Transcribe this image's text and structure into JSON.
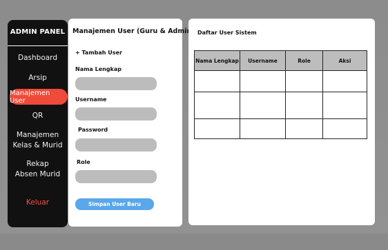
{
  "sidebar": {
    "title": "ADMIN PANEL",
    "items": [
      {
        "label": "Dashboard"
      },
      {
        "label": "Arsip"
      },
      {
        "label": "Manajemen User"
      },
      {
        "label": "QR"
      },
      {
        "label": "Manajemen Kelas & Murid"
      },
      {
        "label": "Rekap Absen Murid"
      },
      {
        "label": "Keluar"
      }
    ],
    "active_color": "#f04a3a"
  },
  "form": {
    "title": "Manajemen User (Guru & Admin)",
    "add_label": "+  Tambah User",
    "fields": [
      {
        "label": "Nama Lengkap",
        "value": ""
      },
      {
        "label": "Username",
        "value": ""
      },
      {
        "label": "Password",
        "value": ""
      },
      {
        "label": "Role",
        "value": ""
      }
    ],
    "save_label": "Simpan User Baru",
    "save_color": "#5aa7ea"
  },
  "table": {
    "title": "Daftar User Sistem",
    "columns": [
      "Nama Lengkap",
      "Username",
      "Role",
      "Aksi"
    ],
    "rows": [
      [
        "",
        "",
        "",
        ""
      ],
      [
        "",
        "",
        "",
        ""
      ],
      [
        "",
        "",
        "",
        ""
      ]
    ]
  }
}
